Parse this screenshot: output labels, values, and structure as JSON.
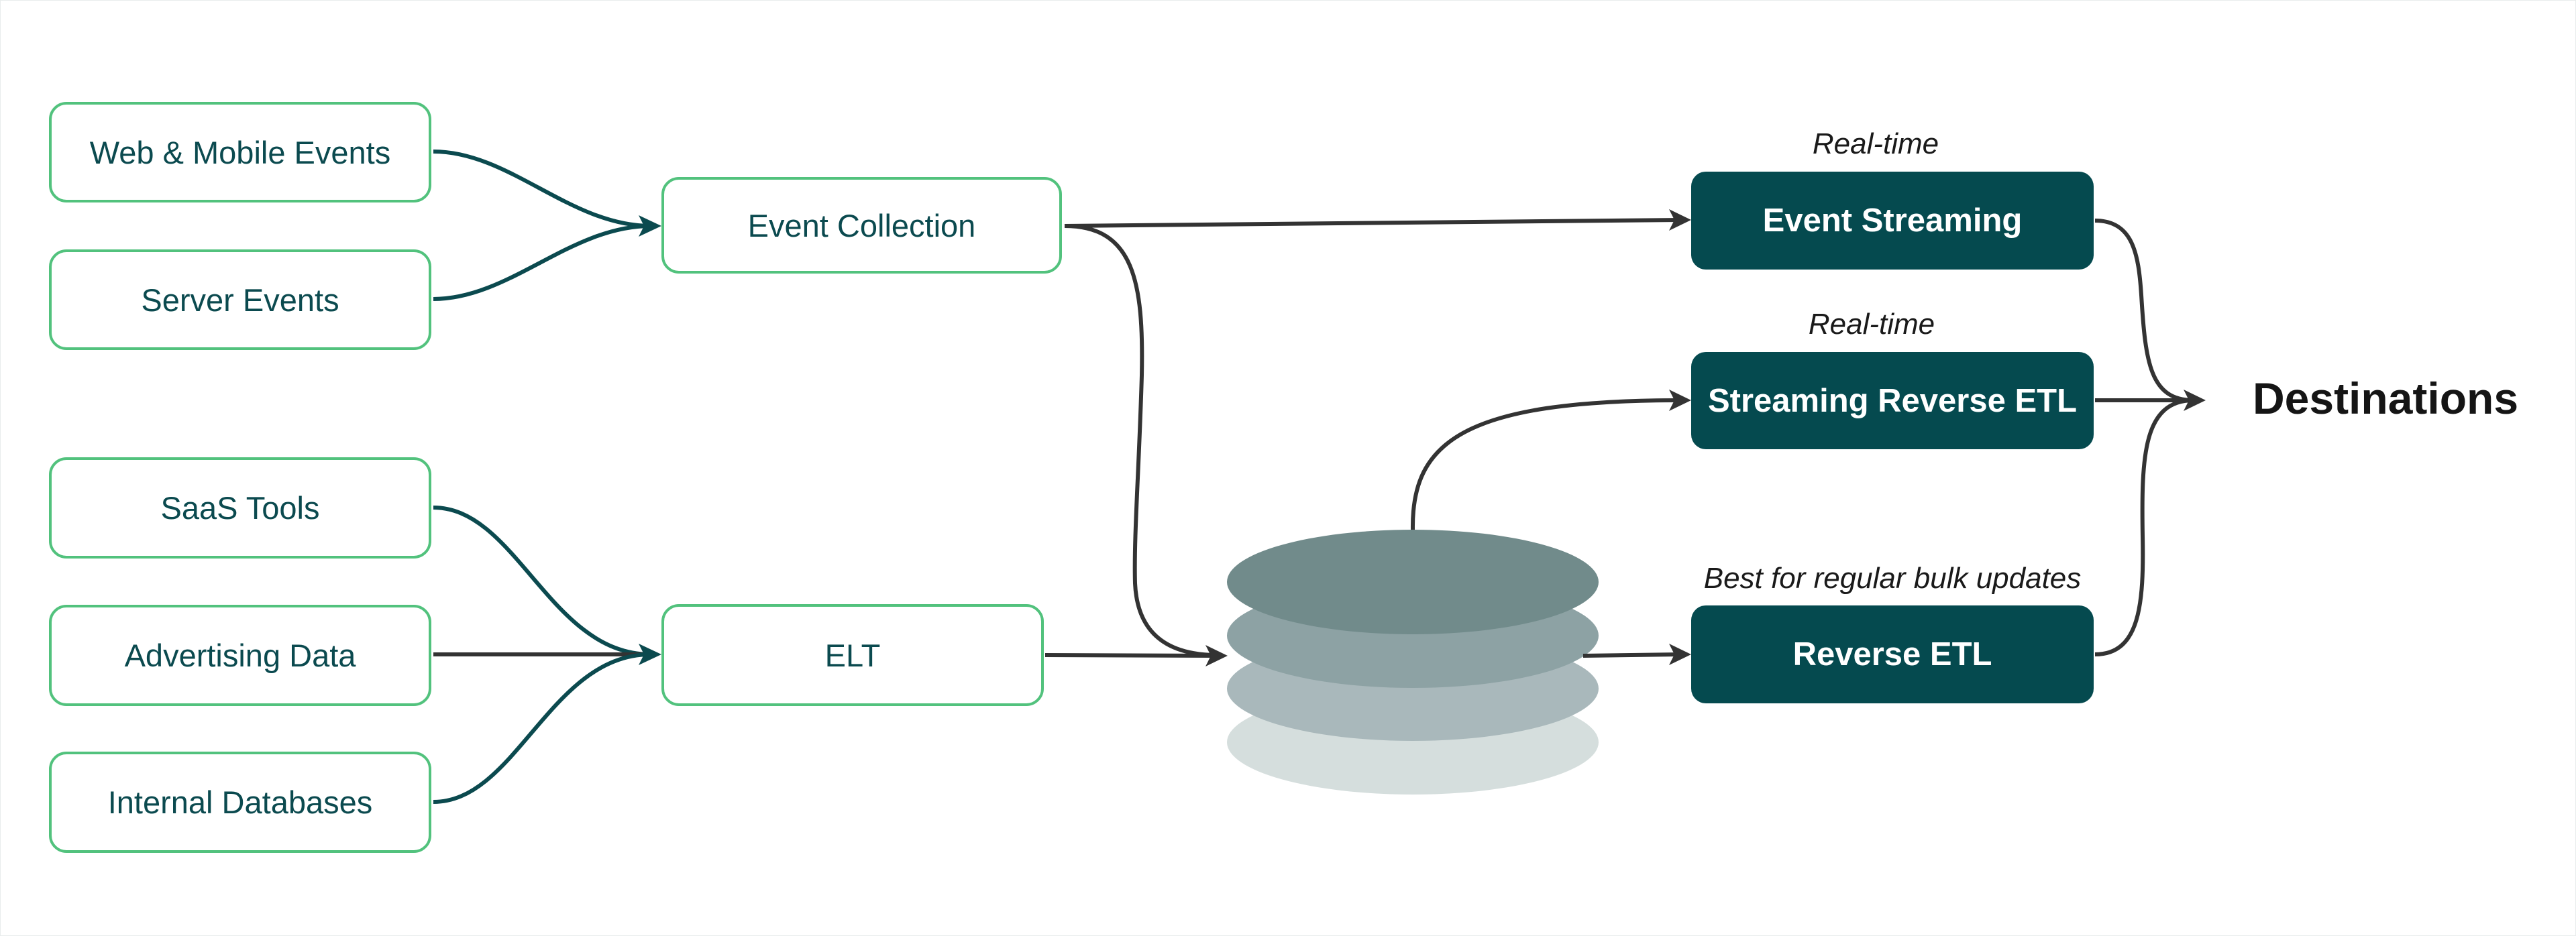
{
  "diagram": {
    "sources": {
      "event_sources": [
        {
          "label": "Web & Mobile Events"
        },
        {
          "label": "Server Events"
        }
      ],
      "data_sources": [
        {
          "label": "SaaS Tools"
        },
        {
          "label": "Advertising Data"
        },
        {
          "label": "Internal Databases"
        }
      ]
    },
    "ingestion": {
      "event_collection": "Event Collection",
      "elt": "ELT"
    },
    "warehouse": {
      "icon": "database-stack-icon",
      "layer_colors": [
        "#718b8b",
        "#8da2a4",
        "#a9b8bb",
        "#d5dedd"
      ]
    },
    "activation": [
      {
        "label": "Event Streaming",
        "note": "Real-time"
      },
      {
        "label": "Streaming Reverse ETL",
        "note": "Real-time"
      },
      {
        "label": "Reverse ETL",
        "note": "Best for regular bulk updates"
      }
    ],
    "destination": "Destinations",
    "colors": {
      "source_border": "#52c27d",
      "source_text": "#0b4a4f",
      "activation_fill": "#054a4f",
      "teal_connector": "#0b4a4f",
      "gray_connector": "#333333"
    }
  }
}
